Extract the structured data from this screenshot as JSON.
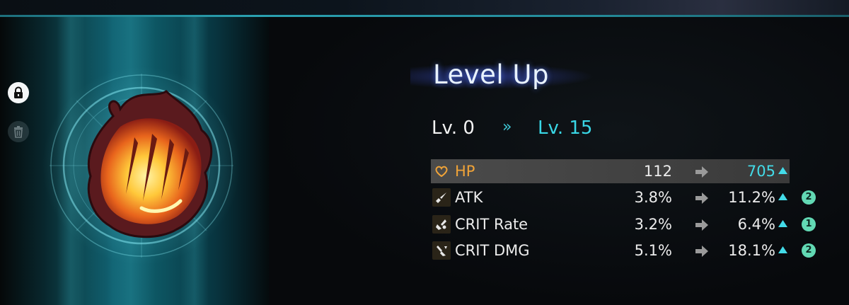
{
  "sidebar": {
    "lock_icon": "lock-icon",
    "discard_icon": "trash-icon"
  },
  "relic": {
    "art_icon": "flame-claw-relic-icon"
  },
  "panel": {
    "title": "Level Up",
    "level_from": "Lv. 0",
    "level_arrow": "»",
    "level_to": "Lv. 15"
  },
  "stats": [
    {
      "icon": "heart-icon",
      "name": "HP",
      "old": "112",
      "new": "705",
      "upgrade_count": null,
      "highlighted": true
    },
    {
      "icon": "sword-icon",
      "name": "ATK",
      "old": "3.8%",
      "new": "11.2%",
      "upgrade_count": "2",
      "highlighted": false
    },
    {
      "icon": "crit-rate-icon",
      "name": "CRIT Rate",
      "old": "3.2%",
      "new": "6.4%",
      "upgrade_count": "1",
      "highlighted": false
    },
    {
      "icon": "crit-dmg-icon",
      "name": "CRIT DMG",
      "old": "5.1%",
      "new": "18.1%",
      "upgrade_count": "2",
      "highlighted": false
    }
  ],
  "colors": {
    "accent_cyan": "#39d7e6",
    "main_stat_orange": "#f0a338",
    "badge_green": "#62d9b4"
  }
}
